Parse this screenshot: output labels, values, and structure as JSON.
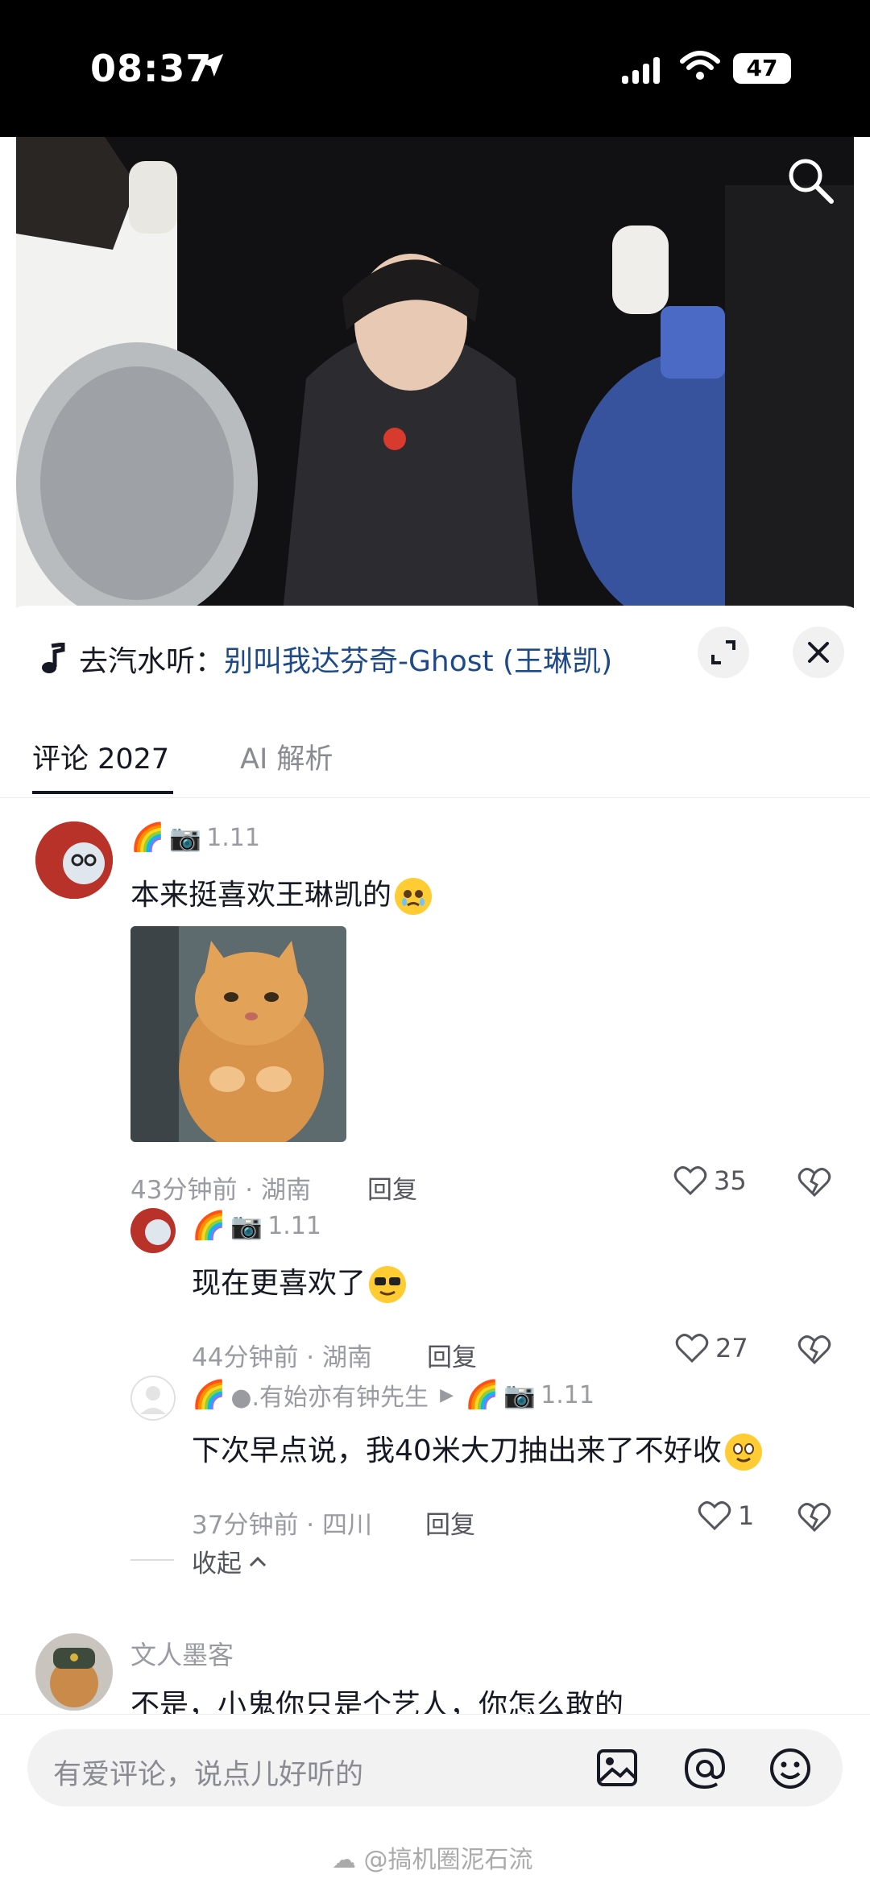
{
  "status_bar": {
    "time": "08:37",
    "battery": "47"
  },
  "video": {
    "search_icon": "search-icon"
  },
  "music_bar": {
    "prefix": "去汽水听：",
    "song": "别叫我达芬奇-Ghost (王琳凯)",
    "expand_icon": "expand-icon",
    "close_icon": "close-icon"
  },
  "tabs": [
    {
      "label": "评论 2027"
    },
    {
      "label": "AI 解析"
    }
  ],
  "comments": [
    {
      "user_suffix": "1.11",
      "text": "本来挺喜欢王琳凯的",
      "emoji": "crying-face-emoji",
      "time_location": "43分钟前 · 湖南",
      "reply_label": "回复",
      "likes": "35"
    }
  ],
  "replies": [
    {
      "user_suffix": "1.11",
      "text": "现在更喜欢了",
      "emoji": "sunglasses-emoji",
      "time_location": "44分钟前 · 湖南",
      "reply_label": "回复",
      "likes": "27"
    },
    {
      "user_name": "●.有始亦有钟先生",
      "target_suffix": "1.11",
      "text": "下次早点说，我40米大刀抽出来了不好收",
      "emoji": "smile-emoji",
      "time_location": "37分钟前 · 四川",
      "reply_label": "回复",
      "likes": "1"
    }
  ],
  "collapse_label": "收起",
  "next_comment": {
    "user": "文人墨客",
    "text": "不是，小鬼你只是个艺人，你怎么敢的"
  },
  "input": {
    "placeholder": "有爱评论，说点儿好听的"
  },
  "watermark": "@搞机圈泥石流",
  "colors": {
    "link": "#1e4a8a",
    "text": "#161823",
    "secondary": "#9a9ba1",
    "emoji": "#ffcc33"
  }
}
